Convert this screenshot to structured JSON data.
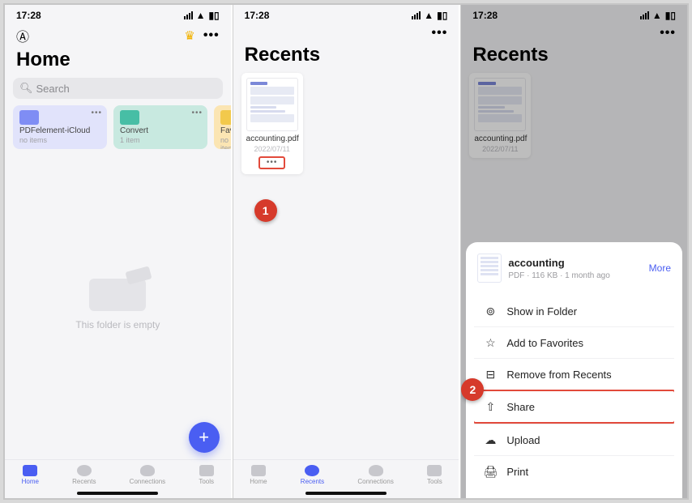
{
  "status": {
    "time": "17:28"
  },
  "screen1": {
    "title": "Home",
    "search": "Search",
    "folders": [
      {
        "name": "PDFelement-iCloud",
        "sub": "no items"
      },
      {
        "name": "Convert",
        "sub": "1 item"
      },
      {
        "name": "Favorite",
        "sub": "no items"
      }
    ],
    "empty": "This folder is empty",
    "tabs": [
      "Home",
      "Recents",
      "Connections",
      "Tools"
    ]
  },
  "screen2": {
    "title": "Recents",
    "card": {
      "name": "accounting.pdf",
      "date": "2022/07/11"
    },
    "tabs": [
      "Home",
      "Recents",
      "Connections",
      "Tools"
    ]
  },
  "screen3": {
    "title": "Recents",
    "card": {
      "name": "accounting.pdf",
      "date": "2022/07/11"
    },
    "sheet": {
      "title": "accounting",
      "meta": "PDF · 116 KB · 1 month ago",
      "more": "More",
      "items": [
        "Show in Folder",
        "Add to Favorites",
        "Remove from Recents",
        "Share",
        "Upload",
        "Print"
      ]
    }
  },
  "callouts": {
    "c1": "1",
    "c2": "2"
  }
}
